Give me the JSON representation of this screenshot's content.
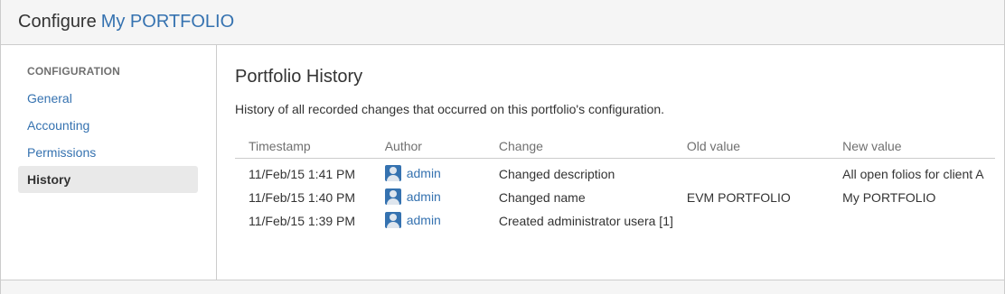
{
  "header": {
    "configure_label": "Configure",
    "portfolio_name": "My PORTFOLIO"
  },
  "sidebar": {
    "heading": "CONFIGURATION",
    "items": [
      {
        "label": "General",
        "active": false
      },
      {
        "label": "Accounting",
        "active": false
      },
      {
        "label": "Permissions",
        "active": false
      },
      {
        "label": "History",
        "active": true
      }
    ]
  },
  "main": {
    "title": "Portfolio History",
    "description": "History of all recorded changes that occurred on this portfolio's configuration.",
    "table": {
      "columns": [
        "Timestamp",
        "Author",
        "Change",
        "Old value",
        "New value"
      ],
      "rows": [
        {
          "timestamp": "11/Feb/15 1:41 PM",
          "author": "admin",
          "change": "Changed description",
          "old_value": "",
          "new_value": "All open folios for client A"
        },
        {
          "timestamp": "11/Feb/15 1:40 PM",
          "author": "admin",
          "change": "Changed name",
          "old_value": "EVM PORTFOLIO",
          "new_value": "My PORTFOLIO"
        },
        {
          "timestamp": "11/Feb/15 1:39 PM",
          "author": "admin",
          "change": "Created administrator usera [1]",
          "old_value": "",
          "new_value": ""
        }
      ]
    }
  },
  "colors": {
    "link": "#3572b0",
    "text": "#333333",
    "muted": "#707070",
    "border": "#cccccc",
    "active_bg": "#e9e9e9"
  },
  "icons": {
    "avatar": "user-avatar-icon"
  }
}
